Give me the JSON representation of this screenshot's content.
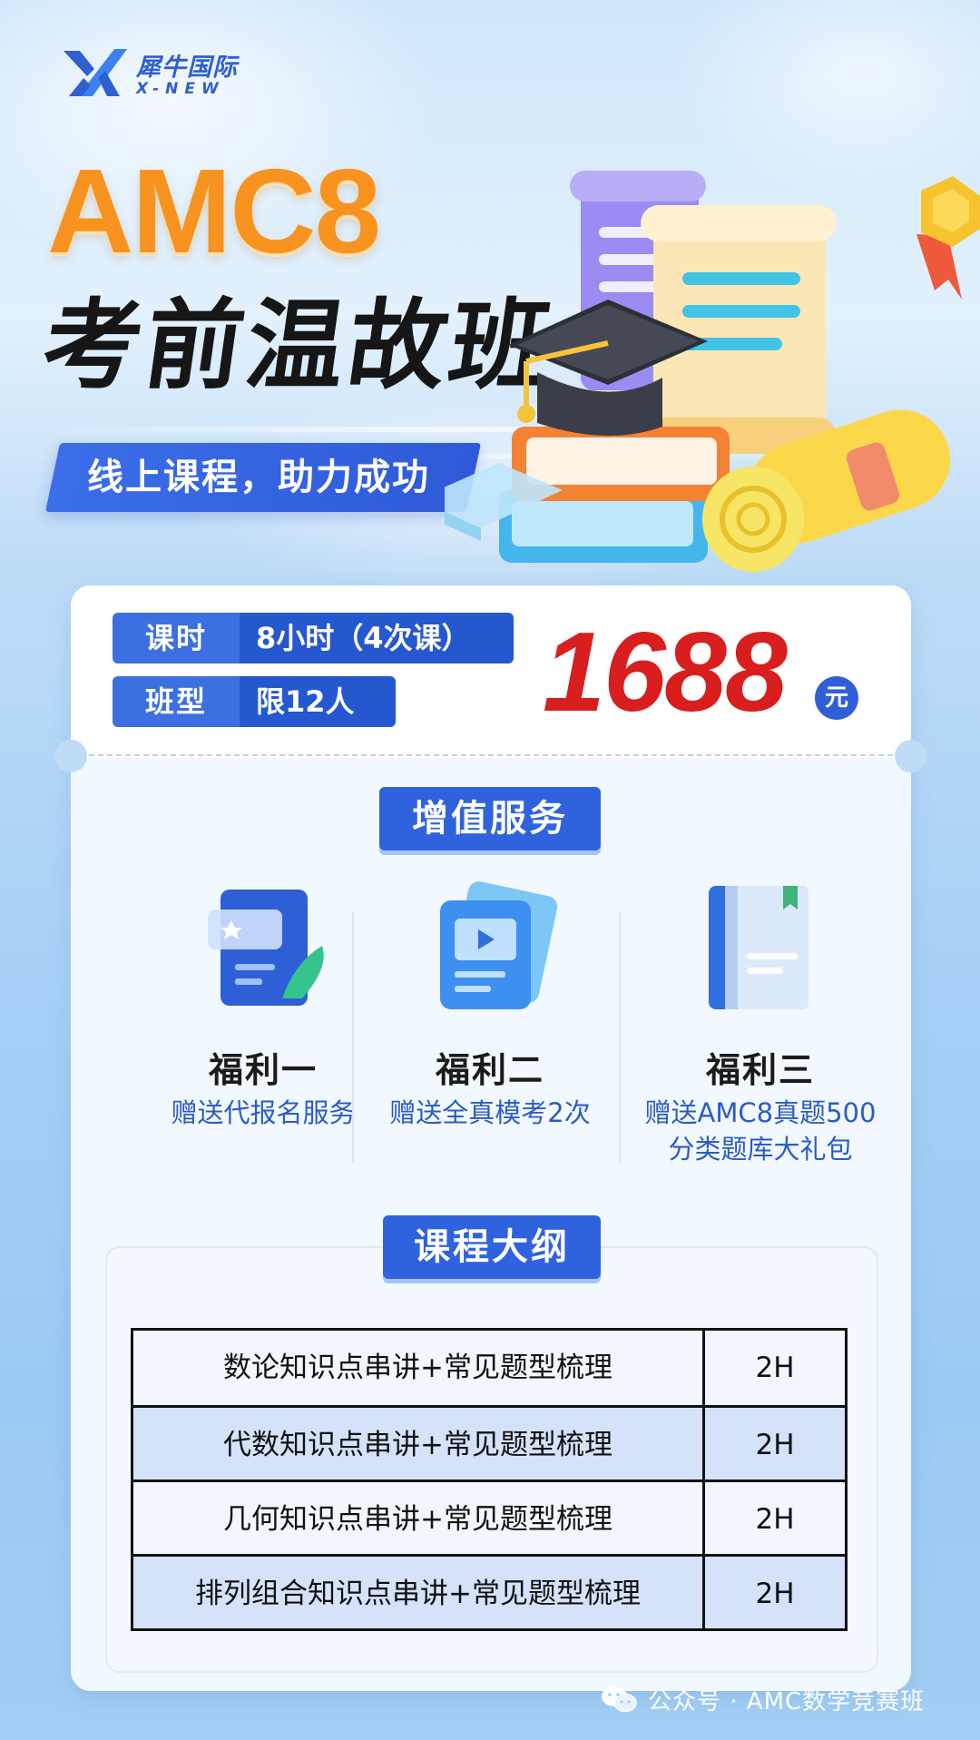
{
  "brand": {
    "name_cn": "犀牛国际",
    "name_en": "X-NEW"
  },
  "hero": {
    "title_en": "AMC8",
    "title_cn": "考前温故班",
    "slogan": "线上课程，助力成功"
  },
  "course_info": {
    "rows": [
      {
        "key": "课时",
        "value": "8小时（4次课）"
      },
      {
        "key": "班型",
        "value": "限12人"
      }
    ],
    "price": "1688",
    "currency": "元"
  },
  "services": {
    "title": "增值服务",
    "items": [
      {
        "title": "福利一",
        "desc": "赠送代报名服务",
        "icon": "document-pen-icon"
      },
      {
        "title": "福利二",
        "desc": "赠送全真模考2次",
        "icon": "video-card-icon"
      },
      {
        "title": "福利三",
        "desc": "赠送AMC8真题500分类题库大礼包",
        "desc_line1": "赠送AMC8真题500",
        "desc_line2": "分类题库大礼包",
        "icon": "book-icon"
      }
    ]
  },
  "outline": {
    "title": "课程大纲",
    "rows": [
      {
        "topic": "数论知识点串讲+常见题型梳理",
        "hours": "2H"
      },
      {
        "topic": "代数知识点串讲+常见题型梳理",
        "hours": "2H"
      },
      {
        "topic": "几何知识点串讲+常见题型梳理",
        "hours": "2H"
      },
      {
        "topic": "排列组合知识点串讲+常见题型梳理",
        "hours": "2H"
      }
    ]
  },
  "footer": {
    "text": "公众号 · AMC数学竞赛班",
    "icon": "wechat-icon"
  },
  "colors": {
    "accent_blue": "#2f63de",
    "title_orange": "#f7931e",
    "price_red": "#d81e1e"
  }
}
